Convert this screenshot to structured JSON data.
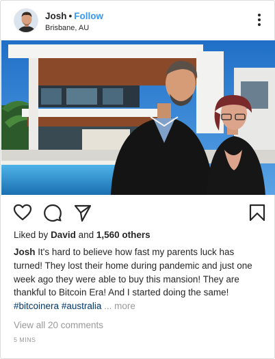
{
  "post": {
    "username": "Josh",
    "separator": "•",
    "follow_label": "Follow",
    "location": "Brisbane, AU",
    "image_alt": "parents in front of mansion",
    "liked_by_prefix": "Liked by",
    "liked_by_user": "David",
    "liked_by_and": "and",
    "liked_by_count": "1,560 others",
    "caption_user": "Josh",
    "caption_text": "It's hard to believe how fast my parents luck has turned! They lost their home during pandemic and just one week ago they were able to buy this mansion! They are thankful to Bitcoin Era! And I started doing the same!",
    "hashtags": [
      "#bitcoinera",
      "#australia"
    ],
    "more_label": "... more",
    "view_comments": "View all 20 comments",
    "timestamp": "5 MINS"
  },
  "colors": {
    "follow": "#3897f0",
    "hashtag": "#003569",
    "muted": "#999999",
    "text": "#262626"
  },
  "icons": {
    "like": "heart-icon",
    "comment": "comment-icon",
    "share": "send-icon",
    "save": "bookmark-icon",
    "menu": "more-vertical-icon"
  }
}
